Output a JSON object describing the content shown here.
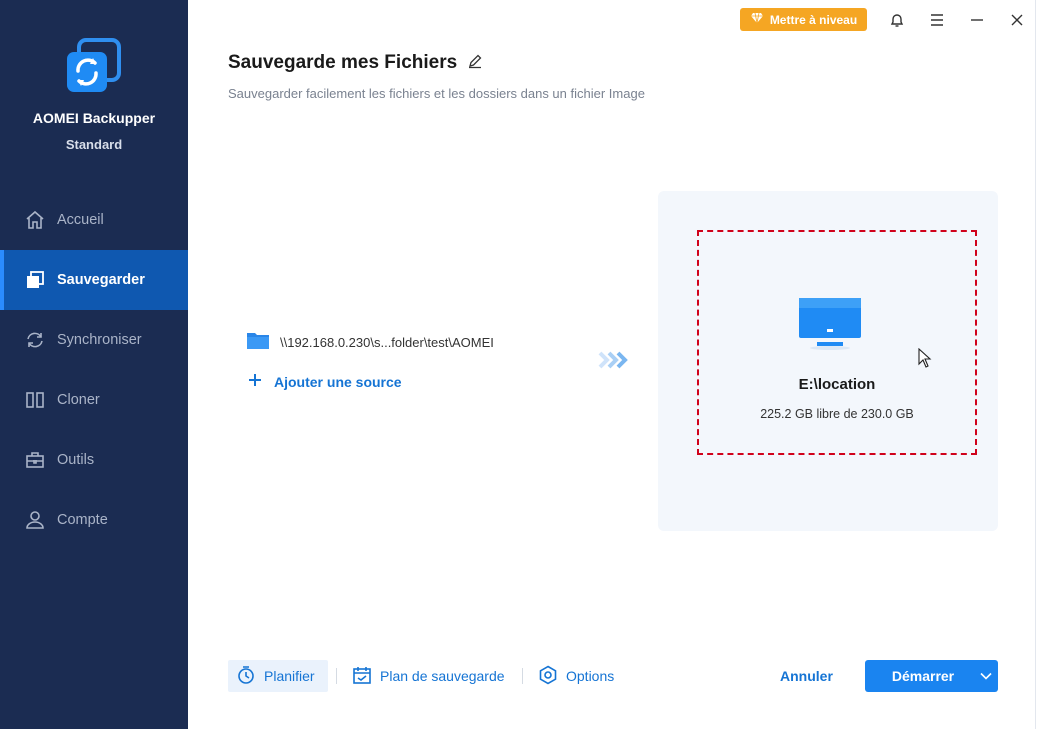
{
  "app": {
    "name": "AOMEI Backupper",
    "edition": "Standard",
    "icon": "sync-logo-icon"
  },
  "titlebar": {
    "upgrade_label": "Mettre à niveau",
    "upgrade_icon": "diamond-icon",
    "buttons": [
      "bell-icon",
      "menu-icon",
      "minimize-icon",
      "close-icon"
    ]
  },
  "sidebar": {
    "items": [
      {
        "label": "Accueil",
        "icon": "home-icon",
        "active": false
      },
      {
        "label": "Sauvegarder",
        "icon": "backup-icon",
        "active": true
      },
      {
        "label": "Synchroniser",
        "icon": "sync-icon",
        "active": false
      },
      {
        "label": "Cloner",
        "icon": "clone-icon",
        "active": false
      },
      {
        "label": "Outils",
        "icon": "toolbox-icon",
        "active": false
      },
      {
        "label": "Compte",
        "icon": "user-icon",
        "active": false
      }
    ]
  },
  "header": {
    "title": "Sauvegarde mes Fichiers",
    "subtitle": "Sauvegarder facilement les fichiers et les dossiers dans un fichier Image"
  },
  "source": {
    "path": "\\\\192.168.0.230\\s...folder\\test\\AOMEI",
    "add_label": "Ajouter une source"
  },
  "destination": {
    "name": "E:\\location",
    "free_space": "225.2 GB libre de 230.0 GB"
  },
  "bottom": {
    "schedule_label": "Planifier",
    "plan_label": "Plan de sauvegarde",
    "options_label": "Options",
    "cancel_label": "Annuler",
    "start_label": "Démarrer"
  },
  "colors": {
    "sidebar_bg": "#1b2c52",
    "active_bg": "#0f58b0",
    "accent": "#1a84f0",
    "upgrade": "#f5a623",
    "dashed_border": "#d0021b"
  }
}
